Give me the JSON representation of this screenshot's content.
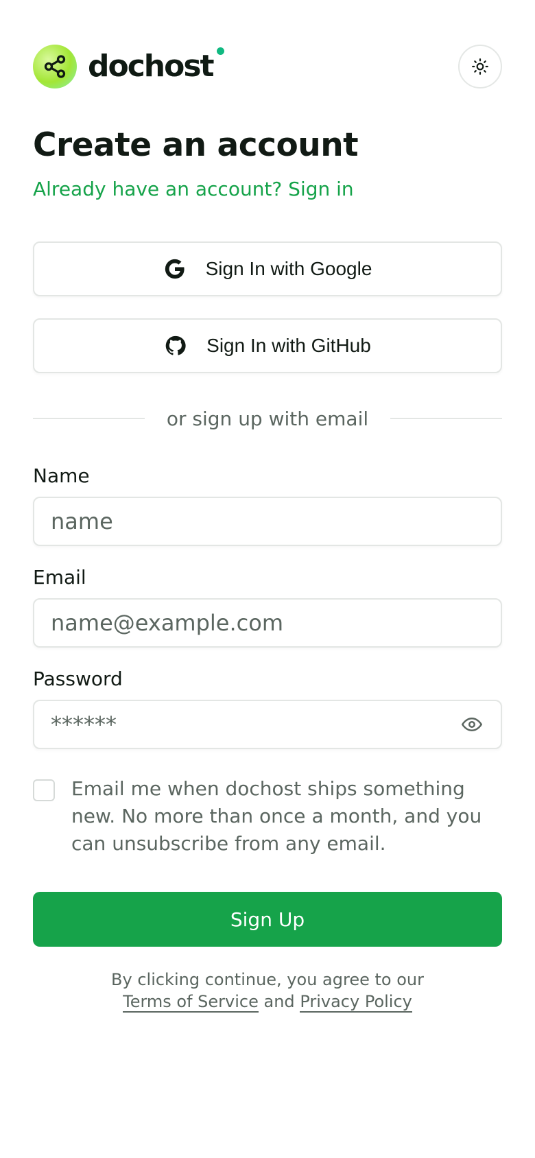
{
  "brand": {
    "name": "dochost",
    "logo_icon": "share-icon",
    "accent": "#16a34a",
    "dot_color": "#10b981"
  },
  "header": {
    "theme_toggle_icon": "sun-icon"
  },
  "page": {
    "title": "Create an account",
    "signin_link": "Already have an account? Sign in"
  },
  "oauth": {
    "google_label": "Sign In with Google",
    "google_icon": "google-icon",
    "github_label": "Sign In with GitHub",
    "github_icon": "github-icon"
  },
  "divider": {
    "text": "or sign up with email"
  },
  "form": {
    "name_label": "Name",
    "name_placeholder": "name",
    "name_value": "",
    "email_label": "Email",
    "email_placeholder": "name@example.com",
    "email_value": "",
    "password_label": "Password",
    "password_placeholder": "******",
    "password_value": "",
    "password_toggle_icon": "eye-icon",
    "optin_text": "Email me when dochost ships something new. No more than once a month, and you can unsubscribe from any email.",
    "optin_checked": false,
    "submit_label": "Sign Up"
  },
  "terms": {
    "prefix": "By clicking continue, you agree to our",
    "tos_label": "Terms of Service",
    "and": "and",
    "privacy_label": "Privacy Policy"
  }
}
